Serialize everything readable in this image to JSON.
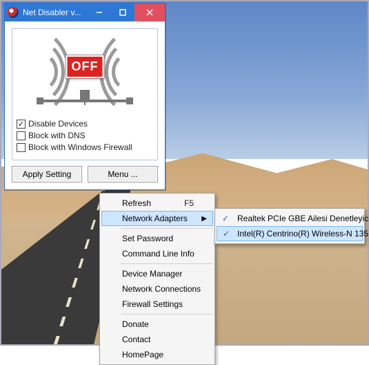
{
  "window": {
    "title": "Net Disabler v...",
    "off_label": "OFF",
    "checks": {
      "disable_devices": {
        "label": "Disable Devices",
        "checked": true
      },
      "block_dns": {
        "label": "Block with DNS",
        "checked": false
      },
      "block_firewall": {
        "label": "Block with Windows Firewall",
        "checked": false
      }
    },
    "apply_label": "Apply Setting",
    "menu_label": "Menu ..."
  },
  "menu": {
    "refresh": {
      "label": "Refresh",
      "shortcut": "F5"
    },
    "adapters": {
      "label": "Network Adapters"
    },
    "set_password": {
      "label": "Set Password"
    },
    "cmdline": {
      "label": "Command Line Info"
    },
    "device_mgr": {
      "label": "Device Manager"
    },
    "net_conns": {
      "label": "Network Connections"
    },
    "fw_settings": {
      "label": "Firewall Settings"
    },
    "donate": {
      "label": "Donate"
    },
    "contact": {
      "label": "Contact"
    },
    "homepage": {
      "label": "HomePage"
    }
  },
  "submenu": {
    "realtek": {
      "label": "Realtek PCIe GBE Ailesi Denetleyici",
      "checked": true
    },
    "intel": {
      "label": "Intel(R) Centrino(R) Wireless-N 135",
      "checked": true,
      "highlight": true
    }
  }
}
